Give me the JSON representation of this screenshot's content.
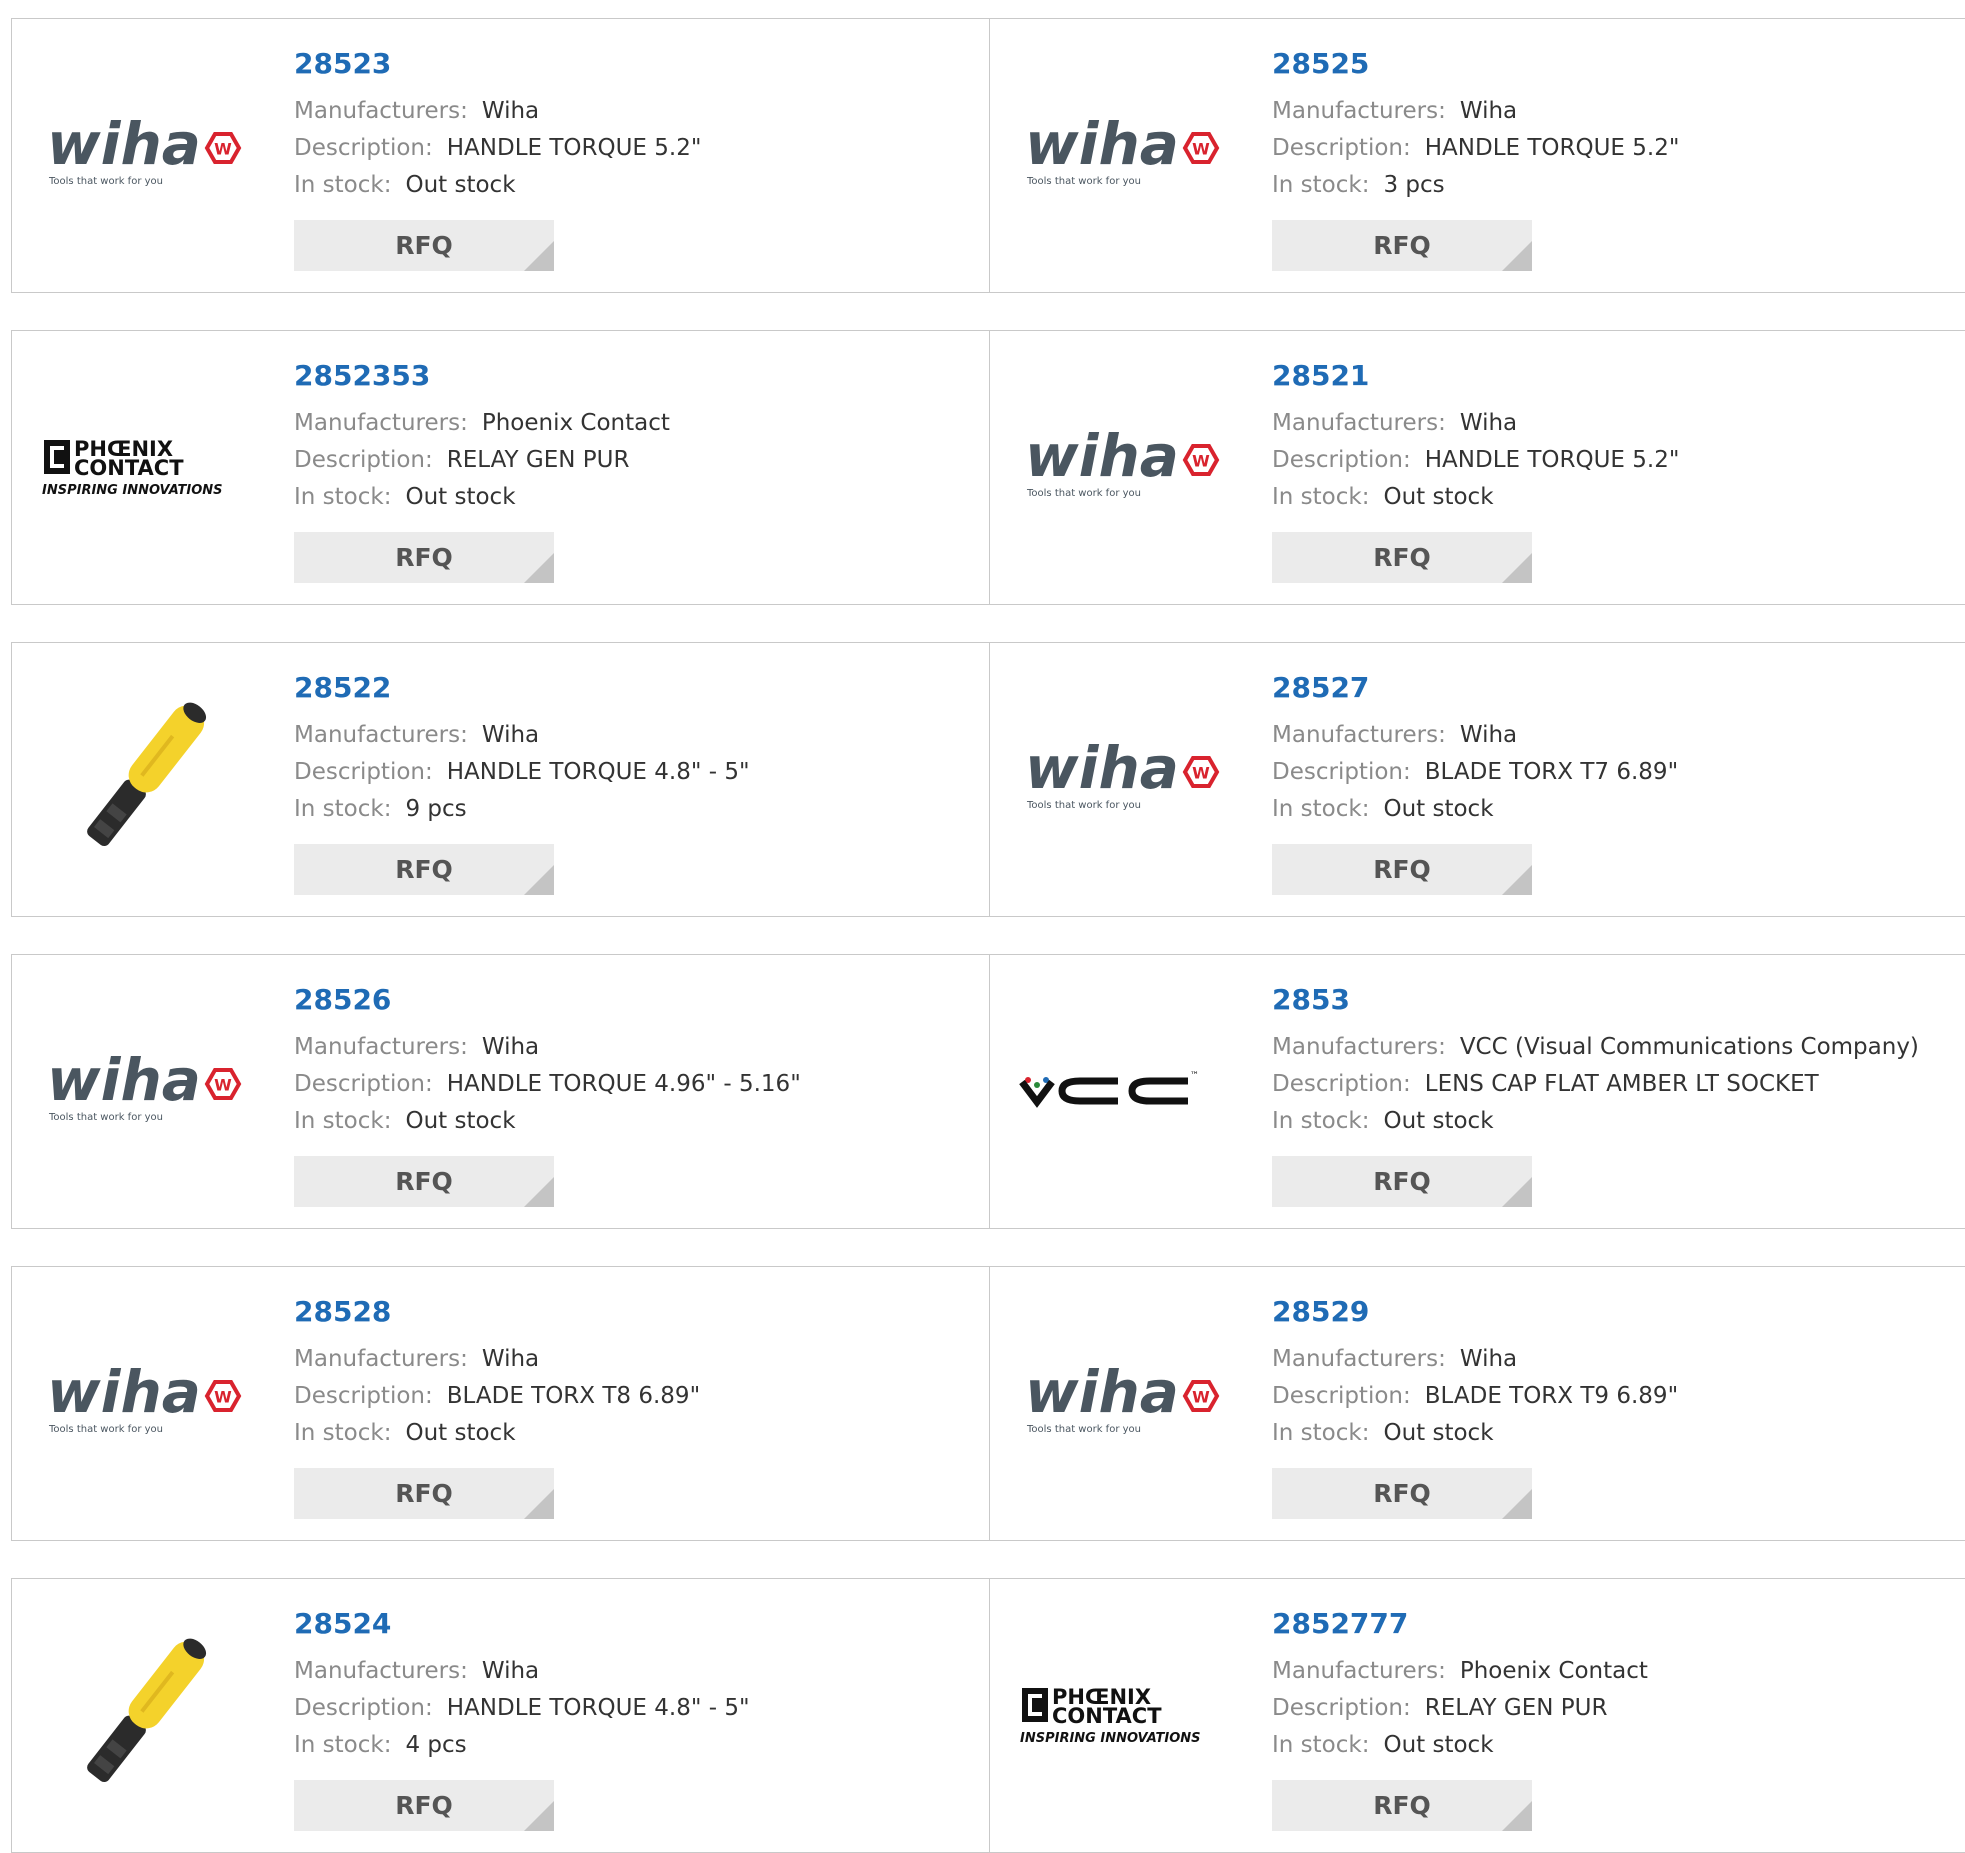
{
  "labels": {
    "manufacturers": "Manufacturers:",
    "description": "Description:",
    "in_stock": "In stock:",
    "rfq": "RFQ"
  },
  "brand_logos": {
    "wiha": {
      "word": "wiha",
      "badge": "W",
      "tagline": "Tools that work for you"
    },
    "phoenix": {
      "line1": "PHŒNIX",
      "line2": "CONTACT",
      "tagline": "INSPIRING INNOVATIONS"
    },
    "vcc": {
      "word": "VCC",
      "tm": "™"
    }
  },
  "colors": {
    "part_link": "#1f6bb5",
    "wiha_gray": "#4a5660",
    "wiha_red": "#d9232e",
    "handle_yellow": "#f4d22b",
    "rfq_bg": "#ebebeb"
  },
  "products": [
    {
      "part_number": "28523",
      "manufacturer": "Wiha",
      "description": "HANDLE TORQUE 5.2\"",
      "stock": "Out stock",
      "image": "wiha-logo"
    },
    {
      "part_number": "28525",
      "manufacturer": "Wiha",
      "description": "HANDLE TORQUE 5.2\"",
      "stock": "3 pcs",
      "image": "wiha-logo"
    },
    {
      "part_number": "2852353",
      "manufacturer": "Phoenix Contact",
      "description": "RELAY GEN PUR",
      "stock": "Out stock",
      "image": "phoenix-contact-logo"
    },
    {
      "part_number": "28521",
      "manufacturer": "Wiha",
      "description": "HANDLE TORQUE 5.2\"",
      "stock": "Out stock",
      "image": "wiha-logo"
    },
    {
      "part_number": "28522",
      "manufacturer": "Wiha",
      "description": "HANDLE TORQUE 4.8\" - 5\"",
      "stock": "9 pcs",
      "image": "torque-handle-photo"
    },
    {
      "part_number": "28527",
      "manufacturer": "Wiha",
      "description": "BLADE TORX T7 6.89\"",
      "stock": "Out stock",
      "image": "wiha-logo"
    },
    {
      "part_number": "28526",
      "manufacturer": "Wiha",
      "description": "HANDLE TORQUE 4.96\" - 5.16\"",
      "stock": "Out stock",
      "image": "wiha-logo"
    },
    {
      "part_number": "2853",
      "manufacturer": "VCC (Visual Communications Company)",
      "description": "LENS CAP FLAT AMBER LT SOCKET",
      "stock": "Out stock",
      "image": "vcc-logo"
    },
    {
      "part_number": "28528",
      "manufacturer": "Wiha",
      "description": "BLADE TORX T8 6.89\"",
      "stock": "Out stock",
      "image": "wiha-logo"
    },
    {
      "part_number": "28529",
      "manufacturer": "Wiha",
      "description": "BLADE TORX T9 6.89\"",
      "stock": "Out stock",
      "image": "wiha-logo"
    },
    {
      "part_number": "28524",
      "manufacturer": "Wiha",
      "description": "HANDLE TORQUE 4.8\" - 5\"",
      "stock": "4 pcs",
      "image": "torque-handle-photo"
    },
    {
      "part_number": "2852777",
      "manufacturer": "Phoenix Contact",
      "description": "RELAY GEN PUR",
      "stock": "Out stock",
      "image": "phoenix-contact-logo"
    }
  ]
}
